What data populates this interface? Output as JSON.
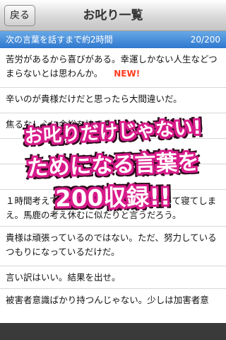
{
  "nav": {
    "back_label": "戻る",
    "title": "お叱り一覧"
  },
  "header": {
    "countdown": "次の言葉を話すまで約2時間",
    "progress": "20/200"
  },
  "rows": [
    {
      "text": "苦労があるから喜びがある。幸運しかない人生などつまらないとは思わんか。",
      "badge": "NEW!"
    },
    {
      "text": "辛いのが貴様だけだと思ったら大間違いだ。"
    },
    {
      "text": "焦るな！心に余裕を持て"
    },
    {
      "text": ""
    },
    {
      "text": ""
    },
    {
      "text": "１時間考えてもわからないなら、早く帰って寝てしまえ。馬鹿の考え休むに似たりと言うだろう。"
    },
    {
      "text": "貴様は頑張っているのではない。ただ、努力しているつもりになっているだけだ。"
    },
    {
      "text": "言い訳はいい。結果を出せ。"
    },
    {
      "text": "被害者意識ばかり持つんじゃない。少しは加害者意"
    }
  ],
  "promo": {
    "line1": "お叱りだけじゃない!",
    "line2": "ためになる言葉を",
    "line3": "200収録!!"
  },
  "colors": {
    "header_blue": "#2f78cf",
    "badge_red": "#ff3b1f",
    "promo_outline": "#d81b8a"
  }
}
